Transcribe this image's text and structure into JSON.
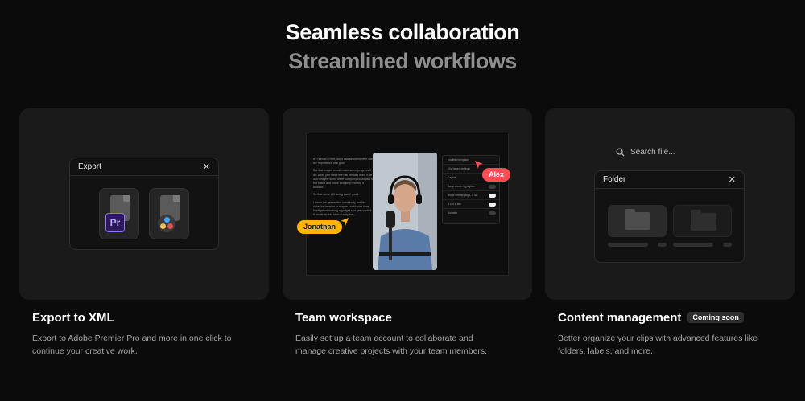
{
  "hero": {
    "title": "Seamless collaboration",
    "subtitle": "Streamlined workflows"
  },
  "export_card": {
    "window_title": "Export",
    "pr_label": "Pr"
  },
  "team_card": {
    "transcript": [
      "It's normal to feel, but it can be overwhelm with the importance of a goal.",
      "But that maybe would make some progress if we could just move the ball forward even if we don't maybe some other company could pick up the baton and move and keep moving it forward.",
      "So that we're still doing sweet good.",
      "I mean we get excited somebody, but like cohesion tension or maybe could work here. Intelligence making a gadget and gain control. It would do this kind of adaptive..."
    ],
    "settings": [
      "Modified template",
      "Clip based settings",
      "Caption",
      "Jump words highlighter",
      "Blank overlay (logo, CTA)",
      "B-roll & title",
      "Animate"
    ],
    "cursor_labels": {
      "alex": "Alex",
      "jonathan": "Jonathan"
    }
  },
  "content_card": {
    "search_placeholder": "Search file...",
    "window_title": "Folder"
  },
  "features": [
    {
      "title": "Export to XML",
      "description": "Export to Adobe Premier Pro and more in one click to continue your creative work.",
      "badge": ""
    },
    {
      "title": "Team workspace",
      "description": "Easily set up a team account to collaborate and manage creative projects with your team members.",
      "badge": ""
    },
    {
      "title": "Content management",
      "description": "Better organize your clips with advanced features like folders, labels, and more.",
      "badge": "Coming soon"
    }
  ],
  "colors": {
    "alex_tag": "#ff4d55",
    "jonathan_tag": "#ffb400",
    "premiere_accent": "#8f77ff"
  }
}
